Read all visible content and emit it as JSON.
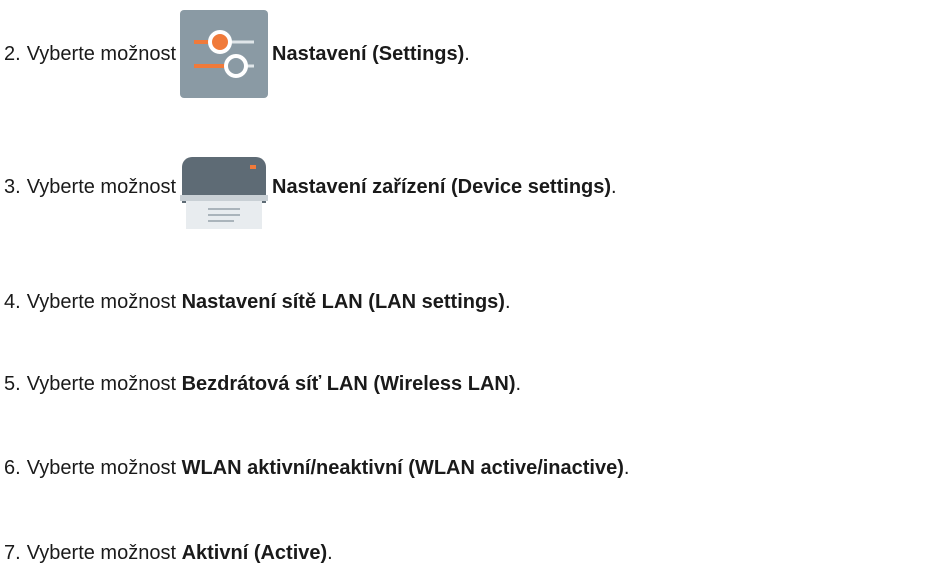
{
  "steps": [
    {
      "num": "2.",
      "prefix": "Vyberte možnost",
      "icon": "settings-sliders-icon",
      "bold": "Nastavení (Settings)",
      "suffix": "."
    },
    {
      "num": "3.",
      "prefix": "Vyberte možnost",
      "icon": "printer-icon",
      "bold": "Nastavení zařízení (Device settings)",
      "suffix": "."
    },
    {
      "num": "4.",
      "prefix": "Vyberte možnost",
      "bold": "Nastavení sítě LAN (LAN settings)",
      "suffix": "."
    },
    {
      "num": "5.",
      "prefix": "Vyberte možnost",
      "bold": "Bezdrátová síť LAN (Wireless LAN)",
      "suffix": "."
    },
    {
      "num": "6.",
      "prefix": "Vyberte možnost",
      "bold": "WLAN aktivní/neaktivní (WLAN active/inactive)",
      "suffix": "."
    },
    {
      "num": "7.",
      "prefix": "Vyberte možnost",
      "bold": "Aktivní (Active)",
      "suffix": "."
    }
  ],
  "colors": {
    "icon_bg": "#8a9aa4",
    "accent_orange": "#f07a3a",
    "printer_body": "#5e6b75",
    "printer_tray": "#e8ecef"
  }
}
